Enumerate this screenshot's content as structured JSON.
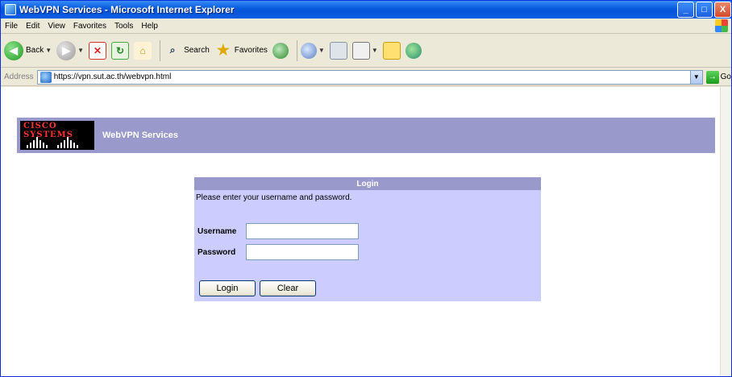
{
  "window": {
    "title": "WebVPN Services - Microsoft Internet Explorer",
    "controls": {
      "minimize": "_",
      "maximize": "□",
      "close": "X"
    }
  },
  "menubar": {
    "items": [
      "File",
      "Edit",
      "View",
      "Favorites",
      "Tools",
      "Help"
    ]
  },
  "toolbar": {
    "back_label": "Back",
    "search_label": "Search",
    "favorites_label": "Favorites"
  },
  "addressbar": {
    "label": "Address",
    "url": "https://vpn.sut.ac.th/webvpn.html",
    "go_label": "Go"
  },
  "banner": {
    "logo_text": "CISCO SYSTEMS",
    "title": "WebVPN Services"
  },
  "login": {
    "header": "Login",
    "message": "Please enter your username and password.",
    "username_label": "Username",
    "username_value": "",
    "password_label": "Password",
    "password_value": "",
    "login_button": "Login",
    "clear_button": "Clear"
  },
  "colors": {
    "banner": "#9999cc",
    "panel": "#ccccff",
    "titlebar": "#0553d8"
  }
}
